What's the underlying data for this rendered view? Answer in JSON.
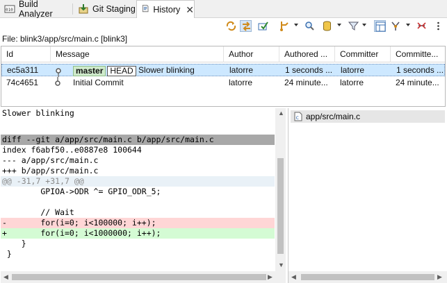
{
  "tabs": [
    {
      "label": "Build Analyzer",
      "icon": "build-analyzer-icon"
    },
    {
      "label": "Git Staging",
      "icon": "git-staging-icon"
    },
    {
      "label": "History",
      "icon": "history-icon"
    }
  ],
  "toolbar": {
    "icons": [
      "link-with-selection-icon",
      "compare-mode-icon",
      "show-all-icon",
      "branch-filter-icon",
      "search-icon",
      "repository-icon",
      "filter-icon",
      "layout-icon",
      "merge-icon",
      "reset-icon",
      "view-menu-icon"
    ]
  },
  "file_info": "File: blink3/app/src/main.c [blink3]",
  "table": {
    "columns": [
      "Id",
      "Message",
      "Author",
      "Authored ...",
      "Committer",
      "Committe..."
    ],
    "rows": [
      {
        "id": "ec5a311",
        "branch": "master",
        "head": "HEAD",
        "message": "Slower blinking",
        "author": "latorre",
        "authored": "1 seconds ...",
        "committer": "latorre",
        "committed": "1 seconds ...",
        "selected": true
      },
      {
        "id": "74c4651",
        "message": "Initial Commit",
        "author": "latorre",
        "authored": "24 minute...",
        "committer": "latorre",
        "committed": "24 minute...",
        "selected": false
      }
    ]
  },
  "diff": {
    "lines": [
      {
        "text": "Slower blinking",
        "kind": "plain"
      },
      {
        "text": "",
        "kind": "plain"
      },
      {
        "text": "",
        "kind": "plain"
      },
      {
        "text": "diff --git a/app/src/main.c b/app/src/main.c",
        "kind": "header"
      },
      {
        "text": "index f6abf50..e0887e8 100644",
        "kind": "plain"
      },
      {
        "text": "--- a/app/src/main.c",
        "kind": "plain"
      },
      {
        "text": "+++ b/app/src/main.c",
        "kind": "plain"
      },
      {
        "text": "@@ -31,7 +31,7 @@",
        "kind": "hunk"
      },
      {
        "text": "        GPIOA->ODR ^= GPIO_ODR_5;",
        "kind": "plain"
      },
      {
        "text": "",
        "kind": "plain"
      },
      {
        "text": "        // Wait",
        "kind": "plain"
      },
      {
        "text": "-       for(i=0; i<100000; i++);",
        "kind": "removed"
      },
      {
        "text": "+       for(i=0; i<1000000; i++);",
        "kind": "added"
      },
      {
        "text": "    }",
        "kind": "plain"
      },
      {
        "text": " }",
        "kind": "plain"
      }
    ]
  },
  "files": [
    "app/src/main.c"
  ],
  "colors": {
    "selection": "#cde8ff",
    "diff_header": "#a8a8a8",
    "hunk": "#e9f1f7",
    "removed": "#ffd6d6",
    "added": "#d4fbd4",
    "branch_badge": "#cfeacb"
  }
}
